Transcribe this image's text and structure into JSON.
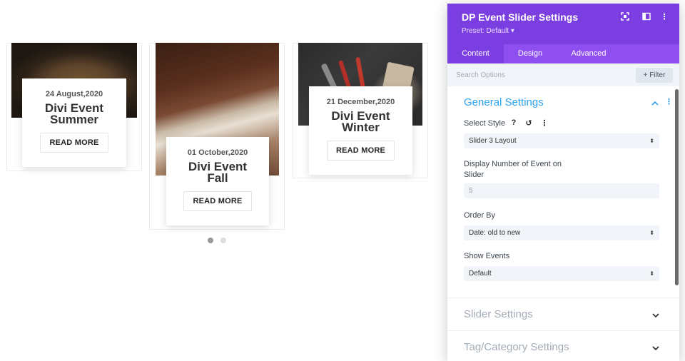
{
  "events": [
    {
      "date": "24 August,2020",
      "title_line1": "Divi Event",
      "title_line2": "Summer",
      "button": "READ MORE"
    },
    {
      "date": "01 October,2020",
      "title_line1": "Divi Event",
      "title_line2": "Fall",
      "button": "READ MORE"
    },
    {
      "date": "21 December,2020",
      "title_line1": "Divi Event",
      "title_line2": "Winter",
      "button": "READ MORE"
    }
  ],
  "slider": {
    "dots": 2,
    "active_dot": 1
  },
  "panel": {
    "title": "DP Event Slider Settings",
    "preset": "Preset: Default ▾",
    "header_icons": [
      "fullscreen-icon",
      "split-view-icon",
      "more-options-icon"
    ],
    "tabs": [
      "Content",
      "Design",
      "Advanced"
    ],
    "active_tab": "Content",
    "search": {
      "placeholder": "Search Options"
    },
    "filter_label": "+ Filter",
    "general": {
      "title": "General Settings",
      "select_style_label": "Select Style",
      "select_style_icons": {
        "help": "?",
        "reset": "↺",
        "more": "⋮"
      },
      "select_style_value": "Slider 3 Layout",
      "display_number_label_line1": "Display Number of Event on",
      "display_number_label_line2": "Slider",
      "display_number_value": "5",
      "order_by_label": "Order By",
      "order_by_value": "Date: old to new",
      "show_events_label": "Show Events",
      "show_events_value": "Default"
    },
    "sections": [
      "Slider Settings",
      "Tag/Category Settings"
    ]
  },
  "colors": {
    "header_purple": "#7b3ee0",
    "tabs_purple": "#8f4ff0",
    "section_blue": "#2ea3f2"
  }
}
